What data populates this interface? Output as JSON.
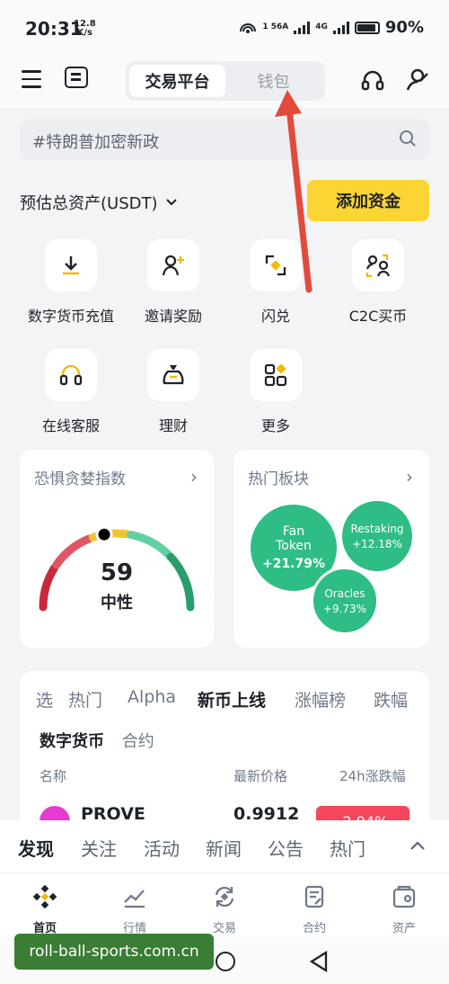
{
  "status_bar": {
    "time": "20:31",
    "speed_value": "12.8",
    "speed_unit": "K/s",
    "net_1": "1 56A",
    "net_2": "4G",
    "battery": "90%"
  },
  "header": {
    "tab_trade": "交易平台",
    "tab_wallet": "钱包"
  },
  "search": {
    "placeholder": "#特朗普加密新政"
  },
  "assets": {
    "label": "预估总资产(USDT)",
    "add_funds": "添加资金"
  },
  "quick_actions": [
    {
      "label": "数字货币充值",
      "icon": "download-icon"
    },
    {
      "label": "邀请奖励",
      "icon": "invite-user-icon"
    },
    {
      "label": "闪兑",
      "icon": "convert-icon"
    },
    {
      "label": "C2C买币",
      "icon": "c2c-icon"
    },
    {
      "label": "在线客服",
      "icon": "headset-icon"
    },
    {
      "label": "理财",
      "icon": "money-bag-icon"
    },
    {
      "label": "更多",
      "icon": "grid-more-icon"
    }
  ],
  "fear_greed": {
    "title": "恐惧贪婪指数",
    "value": "59",
    "status": "中性",
    "level": 0.59
  },
  "hot_sectors": {
    "title": "热门板块",
    "items": [
      {
        "name": "Fan Token",
        "change": "+21.79%"
      },
      {
        "name": "Restaking",
        "change": "+12.18%"
      },
      {
        "name": "Oracles",
        "change": "+9.73%"
      }
    ]
  },
  "market": {
    "tabs": [
      "自选",
      "热门",
      "Alpha",
      "新币上线",
      "涨幅榜",
      "跌幅榜"
    ],
    "tabs_visible": [
      "选",
      "热门",
      "Alpha",
      "新币上线",
      "涨幅榜",
      "跌幅"
    ],
    "active_tab": "新币上线",
    "subtabs": [
      "数字货币",
      "合约"
    ],
    "col_name": "名称",
    "col_price": "最新价格",
    "col_change": "24h涨跌幅",
    "row": {
      "symbol": "PROVE",
      "price": "0.9912",
      "change": "-2.94%"
    }
  },
  "discover_tabs": [
    "发现",
    "关注",
    "活动",
    "新闻",
    "公告",
    "热门"
  ],
  "bottom_nav": [
    {
      "label": "首页",
      "icon": "home-icon"
    },
    {
      "label": "行情",
      "icon": "markets-icon"
    },
    {
      "label": "交易",
      "icon": "trade-icon"
    },
    {
      "label": "合约",
      "icon": "futures-icon"
    },
    {
      "label": "资产",
      "icon": "wallet-icon"
    }
  ],
  "watermark": "roll-ball-sports.com.cn",
  "colors": {
    "accent": "#fcd535",
    "green": "#2ebd85",
    "red": "#e53935",
    "arrow": "#e24a3b"
  }
}
